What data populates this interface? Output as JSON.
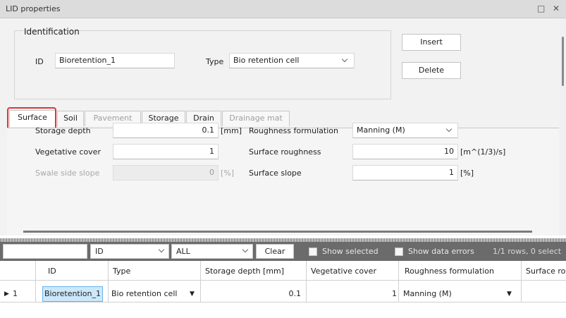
{
  "window": {
    "title": "LID properties"
  },
  "identification": {
    "legend": "Identification",
    "id_label": "ID",
    "id_value": "Bioretention_1",
    "type_label": "Type",
    "type_value": "Bio retention cell",
    "insert_label": "Insert",
    "delete_label": "Delete"
  },
  "tabs": [
    {
      "label": "Surface",
      "state": "active"
    },
    {
      "label": "Soil",
      "state": "enabled"
    },
    {
      "label": "Pavement",
      "state": "disabled"
    },
    {
      "label": "Storage",
      "state": "enabled"
    },
    {
      "label": "Drain",
      "state": "enabled"
    },
    {
      "label": "Drainage mat",
      "state": "disabled"
    }
  ],
  "surface": {
    "storage_depth": {
      "label": "Storage depth",
      "value": "0.1",
      "unit": "[mm]"
    },
    "vegetative_cover": {
      "label": "Vegetative cover",
      "value": "1"
    },
    "swale_side_slope": {
      "label": "Swale side slope",
      "value": "0",
      "unit": "[%]"
    },
    "roughness_formulation": {
      "label": "Roughness formulation",
      "value": "Manning (M)"
    },
    "surface_roughness": {
      "label": "Surface roughness",
      "value": "10",
      "unit": "[m^(1/3)/s]"
    },
    "surface_slope": {
      "label": "Surface slope",
      "value": "1",
      "unit": "[%]"
    }
  },
  "grid_toolbar": {
    "filter_value": "",
    "column_select": "ID",
    "scope_select": "ALL",
    "clear_label": "Clear",
    "show_selected_label": "Show selected",
    "show_errors_label": "Show data errors",
    "status": "1/1 rows, 0 select"
  },
  "grid": {
    "columns": [
      "ID",
      "Type",
      "Storage depth [mm]",
      "Vegetative cover",
      "Roughness formulation",
      "Surface ro"
    ],
    "rows": [
      {
        "index": "1",
        "cells": [
          "Bioretention_1",
          "Bio retention cell",
          "0.1",
          "1",
          "Manning (M)",
          ""
        ]
      }
    ]
  },
  "colors": {
    "highlight": "#d9383a",
    "toolbar_bg": "#6b6b6b",
    "selected_cell": "#cce8fb"
  }
}
